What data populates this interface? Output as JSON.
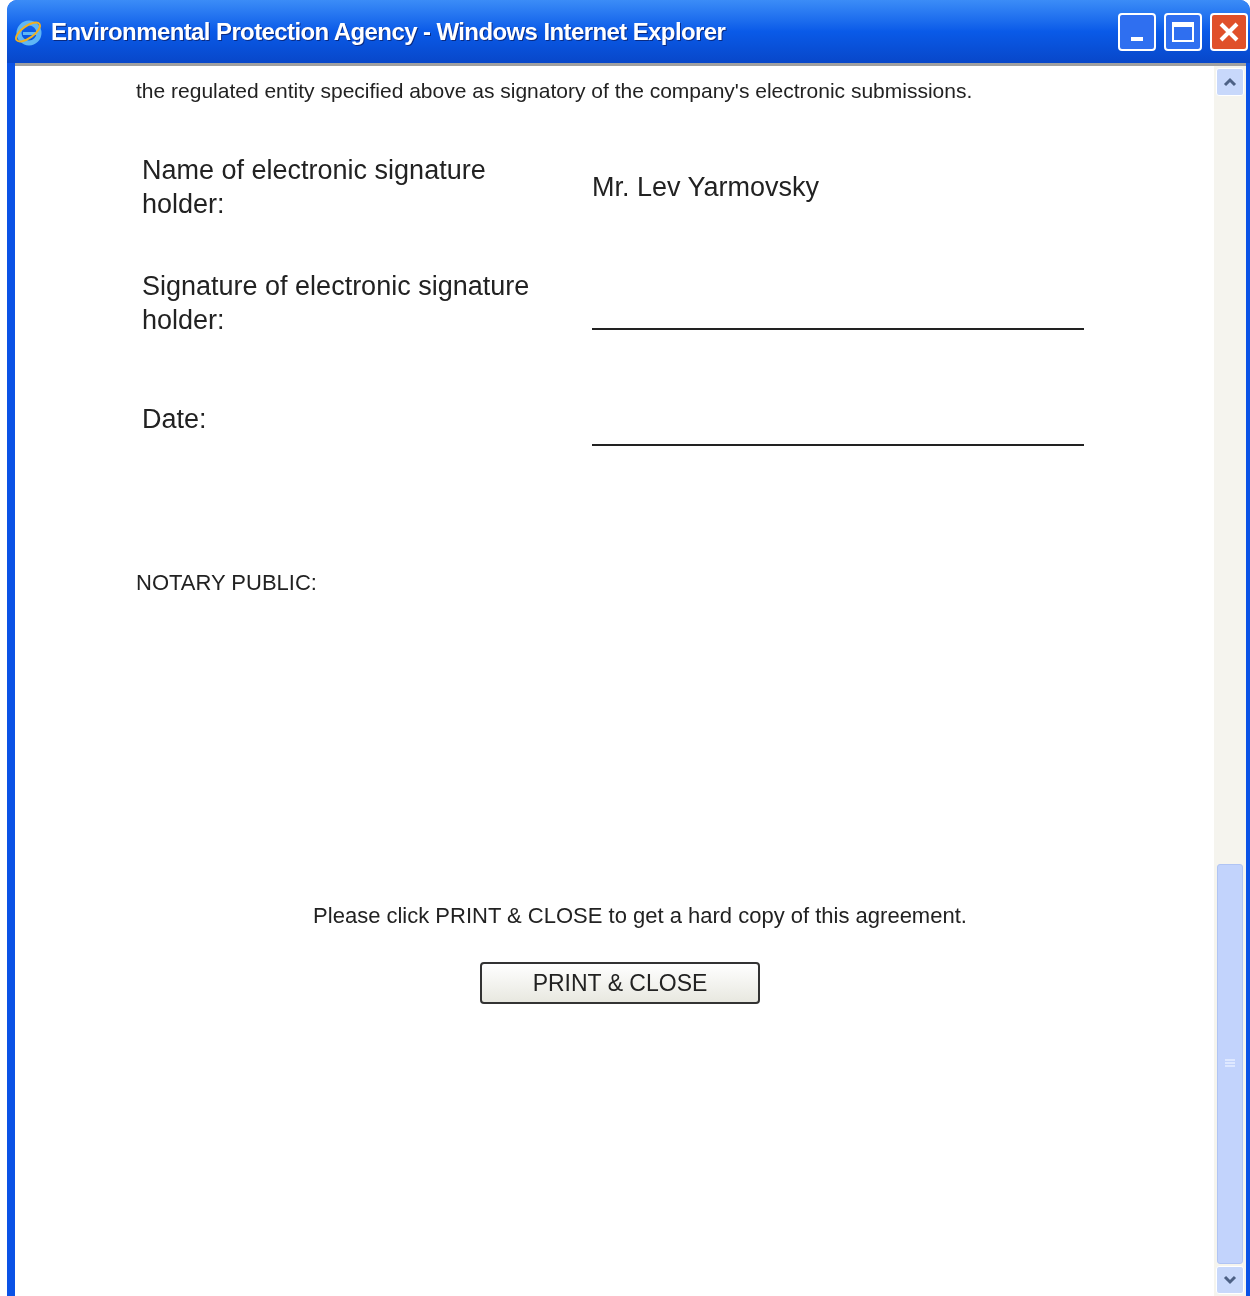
{
  "window": {
    "title": "Environmental Protection Agency - Windows Internet Explorer"
  },
  "intro": "the regulated entity specified above as signatory of the company's electronic submissions.",
  "fields": [
    {
      "label": "Name of electronic signature holder:",
      "kind": "value",
      "value": "Mr. Lev Yarmovsky"
    },
    {
      "label": "Signature of electronic signature holder:",
      "kind": "blank"
    },
    {
      "label": "Date:",
      "kind": "blank"
    }
  ],
  "notary": "NOTARY PUBLIC:",
  "instruction": "Please click PRINT & CLOSE to get a hard copy of this agreement.",
  "button": "PRINT & CLOSE"
}
